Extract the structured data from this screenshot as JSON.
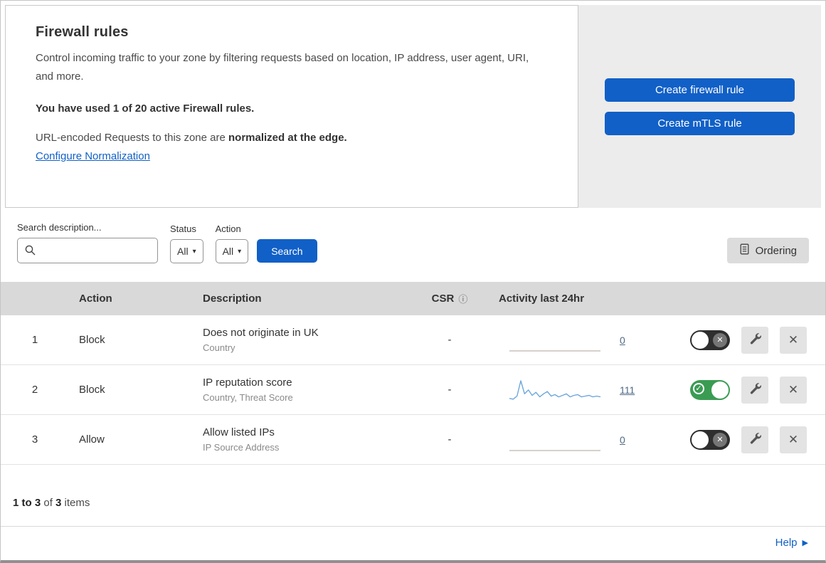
{
  "colors": {
    "accent": "#1160c7",
    "toggle_on": "#3a9c53",
    "count_link": "#4e6a85"
  },
  "header": {
    "title": "Firewall rules",
    "description": "Control incoming traffic to your zone by filtering requests based on location, IP address, user agent, URI, and more.",
    "usage_line": "You have used 1 of 20 active Firewall rules.",
    "normalization_text": "URL-encoded Requests to this zone are ",
    "normalization_bold": "normalized at the edge.",
    "normalization_link": "Configure Normalization",
    "create_firewall_button": "Create firewall rule",
    "create_mtls_button": "Create mTLS rule"
  },
  "filters": {
    "search_label": "Search description...",
    "status_label": "Status",
    "status_value": "All",
    "action_label": "Action",
    "action_value": "All",
    "search_button": "Search",
    "ordering_button": "Ordering"
  },
  "table": {
    "headers": {
      "action": "Action",
      "description": "Description",
      "csr": "CSR",
      "csr_info_icon": "ⓘ",
      "activity": "Activity last 24hr"
    },
    "rows": [
      {
        "index": "1",
        "action": "Block",
        "title": "Does not originate in UK",
        "subtitle": "Country",
        "csr": "-",
        "count": "0",
        "enabled": false,
        "sparkline": [
          0,
          0,
          0,
          0,
          0,
          0,
          0,
          0,
          0,
          0,
          0,
          0
        ],
        "spark_color": "#c8c2ba"
      },
      {
        "index": "2",
        "action": "Block",
        "title": "IP reputation score",
        "subtitle": "Country, Threat Score",
        "csr": "-",
        "count": "111",
        "enabled": true,
        "sparkline": [
          3,
          2,
          6,
          26,
          9,
          14,
          7,
          11,
          5,
          9,
          12,
          6,
          8,
          5,
          7,
          9,
          5,
          7,
          8,
          5,
          6,
          7,
          5,
          6,
          5
        ],
        "spark_color": "#6da7dc"
      },
      {
        "index": "3",
        "action": "Allow",
        "title": "Allow listed IPs",
        "subtitle": "IP Source Address",
        "csr": "-",
        "count": "0",
        "enabled": false,
        "sparkline": [
          0,
          0,
          0,
          0,
          0,
          0,
          0,
          0,
          0,
          0,
          0,
          0
        ],
        "spark_color": "#c8c2ba"
      }
    ]
  },
  "footer": {
    "range": "1 to 3",
    "of_text": " of ",
    "total": "3",
    "items_text": " items",
    "help_label": "Help",
    "help_arrow": "▶"
  }
}
